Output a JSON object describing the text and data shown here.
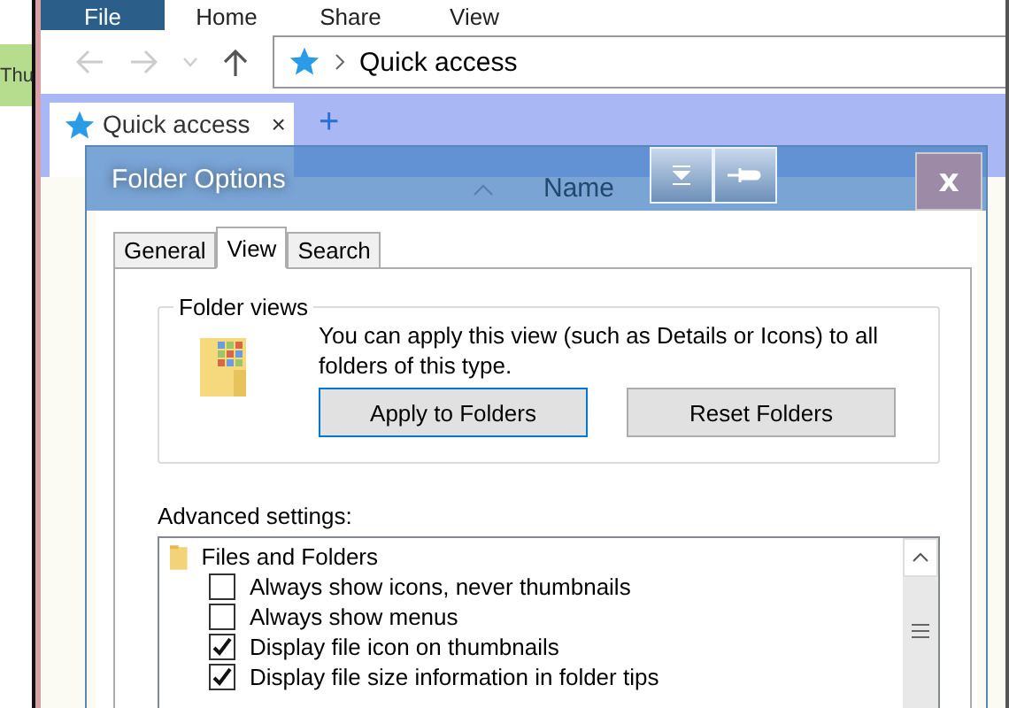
{
  "side_window": {
    "text": "Thu"
  },
  "explorer": {
    "ribbon_tabs": [
      {
        "label": "File",
        "selected": true
      },
      {
        "label": "Home",
        "selected": false
      },
      {
        "label": "Share",
        "selected": false
      },
      {
        "label": "View",
        "selected": false
      }
    ],
    "address": "Quick access",
    "tabs": [
      {
        "label": "Quick access",
        "close": "×"
      }
    ],
    "new_tab": "+",
    "column_header": "Name"
  },
  "dialog": {
    "title": "Folder Options",
    "close": "x",
    "tabs": [
      {
        "label": "General",
        "selected": false
      },
      {
        "label": "View",
        "selected": true
      },
      {
        "label": "Search",
        "selected": false
      }
    ],
    "folder_views": {
      "legend": "Folder views",
      "description": "You can apply this view (such as Details or Icons) to all folders of this type.",
      "buttons": [
        {
          "label": "Apply to Folders",
          "focused": true
        },
        {
          "label": "Reset Folders",
          "focused": false
        }
      ]
    },
    "advanced_label": "Advanced settings:",
    "tree": [
      {
        "label": "Files and Folders",
        "kind": "folder",
        "children": [
          {
            "label": "Always show icons, never thumbnails",
            "kind": "checkbox",
            "checked": false
          },
          {
            "label": "Always show menus",
            "kind": "checkbox",
            "checked": false
          },
          {
            "label": "Display file icon on thumbnails",
            "kind": "checkbox",
            "checked": true
          },
          {
            "label": "Display file size information in folder tips",
            "kind": "checkbox",
            "checked": true
          }
        ]
      }
    ]
  }
}
